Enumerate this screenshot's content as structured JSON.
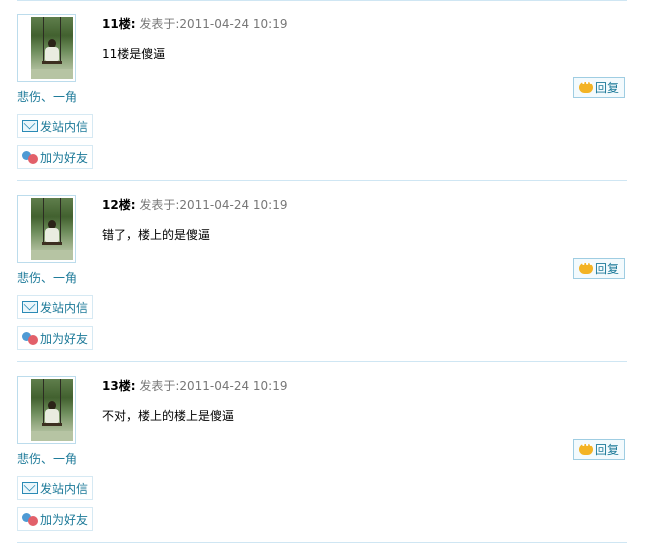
{
  "posts": [
    {
      "floor": "11楼:",
      "meta": " 发表于:2011-04-24 10:19",
      "content": "11楼是傻逼",
      "username": "悲伤、一角",
      "send_message": "发站内信",
      "add_friend": "加为好友",
      "reply": "回复"
    },
    {
      "floor": "12楼:",
      "meta": " 发表于:2011-04-24 10:19",
      "content": "错了，楼上的是傻逼",
      "username": "悲伤、一角",
      "send_message": "发站内信",
      "add_friend": "加为好友",
      "reply": "回复"
    },
    {
      "floor": "13楼:",
      "meta": " 发表于:2011-04-24 10:19",
      "content": "不对，楼上的楼上是傻逼",
      "username": "悲伤、一角",
      "send_message": "发站内信",
      "add_friend": "加为好友",
      "reply": "回复"
    }
  ],
  "icons": {
    "avatar": "avatar-photo",
    "mail": "mail-icon",
    "friends": "friends-icon",
    "reply": "speech-bubble-icon"
  },
  "colors": {
    "link": "#1d7a99",
    "separator": "#cfe6f3",
    "meta": "#777777"
  }
}
